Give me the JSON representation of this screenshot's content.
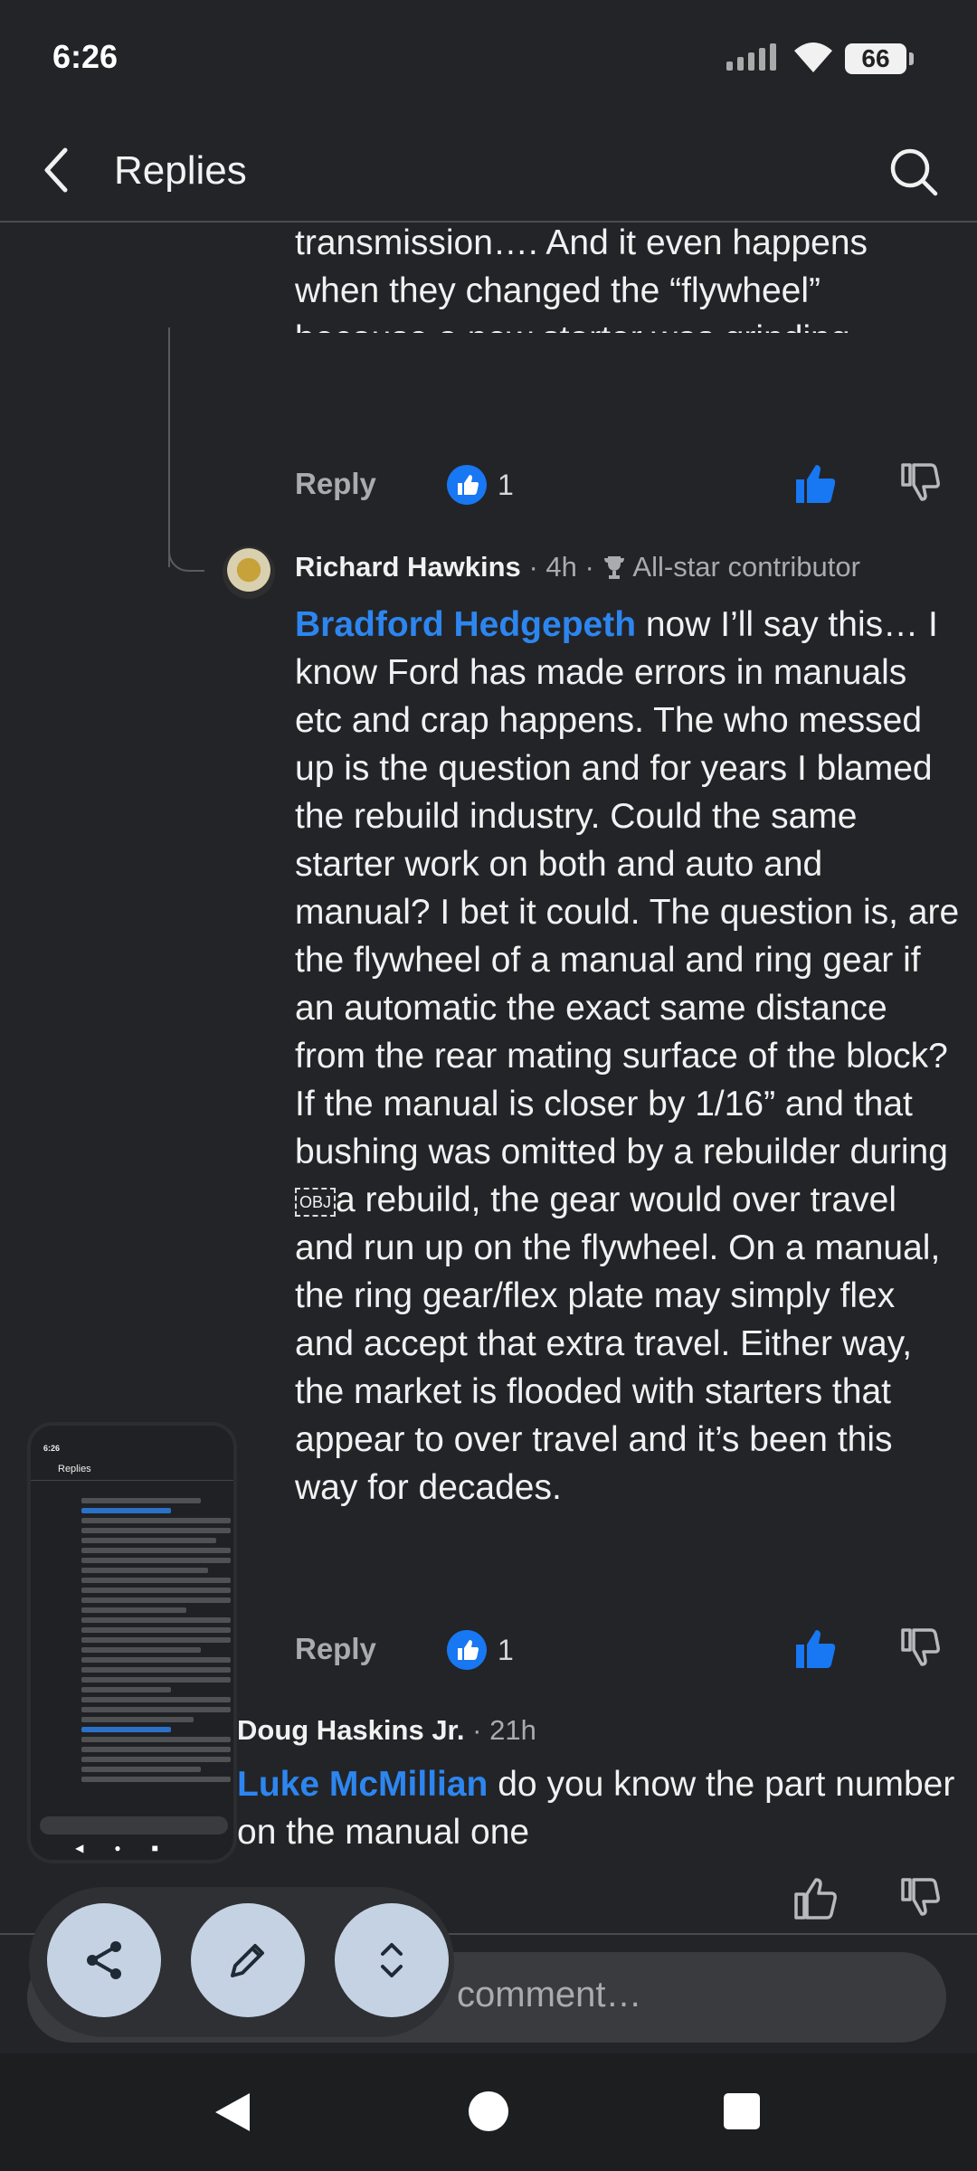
{
  "status_bar": {
    "time": "6:26",
    "battery": "66"
  },
  "app_bar": {
    "title": "Replies"
  },
  "previous_comment": {
    "text_tail": "transmission…. And it even happens when they changed the “flywheel” because a new starter was grinding….",
    "reply_label": "Reply",
    "like_count": "1"
  },
  "comment_1": {
    "author": "Richard Hawkins",
    "time": "4h",
    "badge": "All-star contributor",
    "mention": "Bradford Hedgepeth",
    "text_before_obj": " now I’ll say this… I know Ford has made errors in manuals etc and crap happens. The who messed up is the question and for years I blamed the rebuild industry. Could the same starter work on both and auto and manual? I bet it could. The question is, are the flywheel of a manual and ring gear if an automatic the exact same distance from the rear mating surface of the block? If the manual is closer by 1/16” and that bushing was omitted by a rebuilder during ",
    "obj_label": "OBJ",
    "text_after_obj": "a rebuild, the gear would over travel and run up on the flywheel. On a manual, the ring gear/flex plate may simply flex and accept that extra travel. Either way, the market is flooded with starters that appear to over travel and it’s been this way for decades.",
    "reply_label": "Reply",
    "like_count": "1"
  },
  "comment_2": {
    "author": "Doug Haskins Jr.",
    "time": "21h",
    "mention": "Luke McMillian",
    "text": " do you know the part number on the manual one"
  },
  "composer": {
    "placeholder": "Write a public comment…",
    "visible_text": "comment…"
  },
  "mini_preview": {
    "time": "6:26",
    "title": "Replies"
  },
  "colors": {
    "background": "#232427",
    "accent_blue": "#2d86f0",
    "fab": "#c4d2e3"
  }
}
